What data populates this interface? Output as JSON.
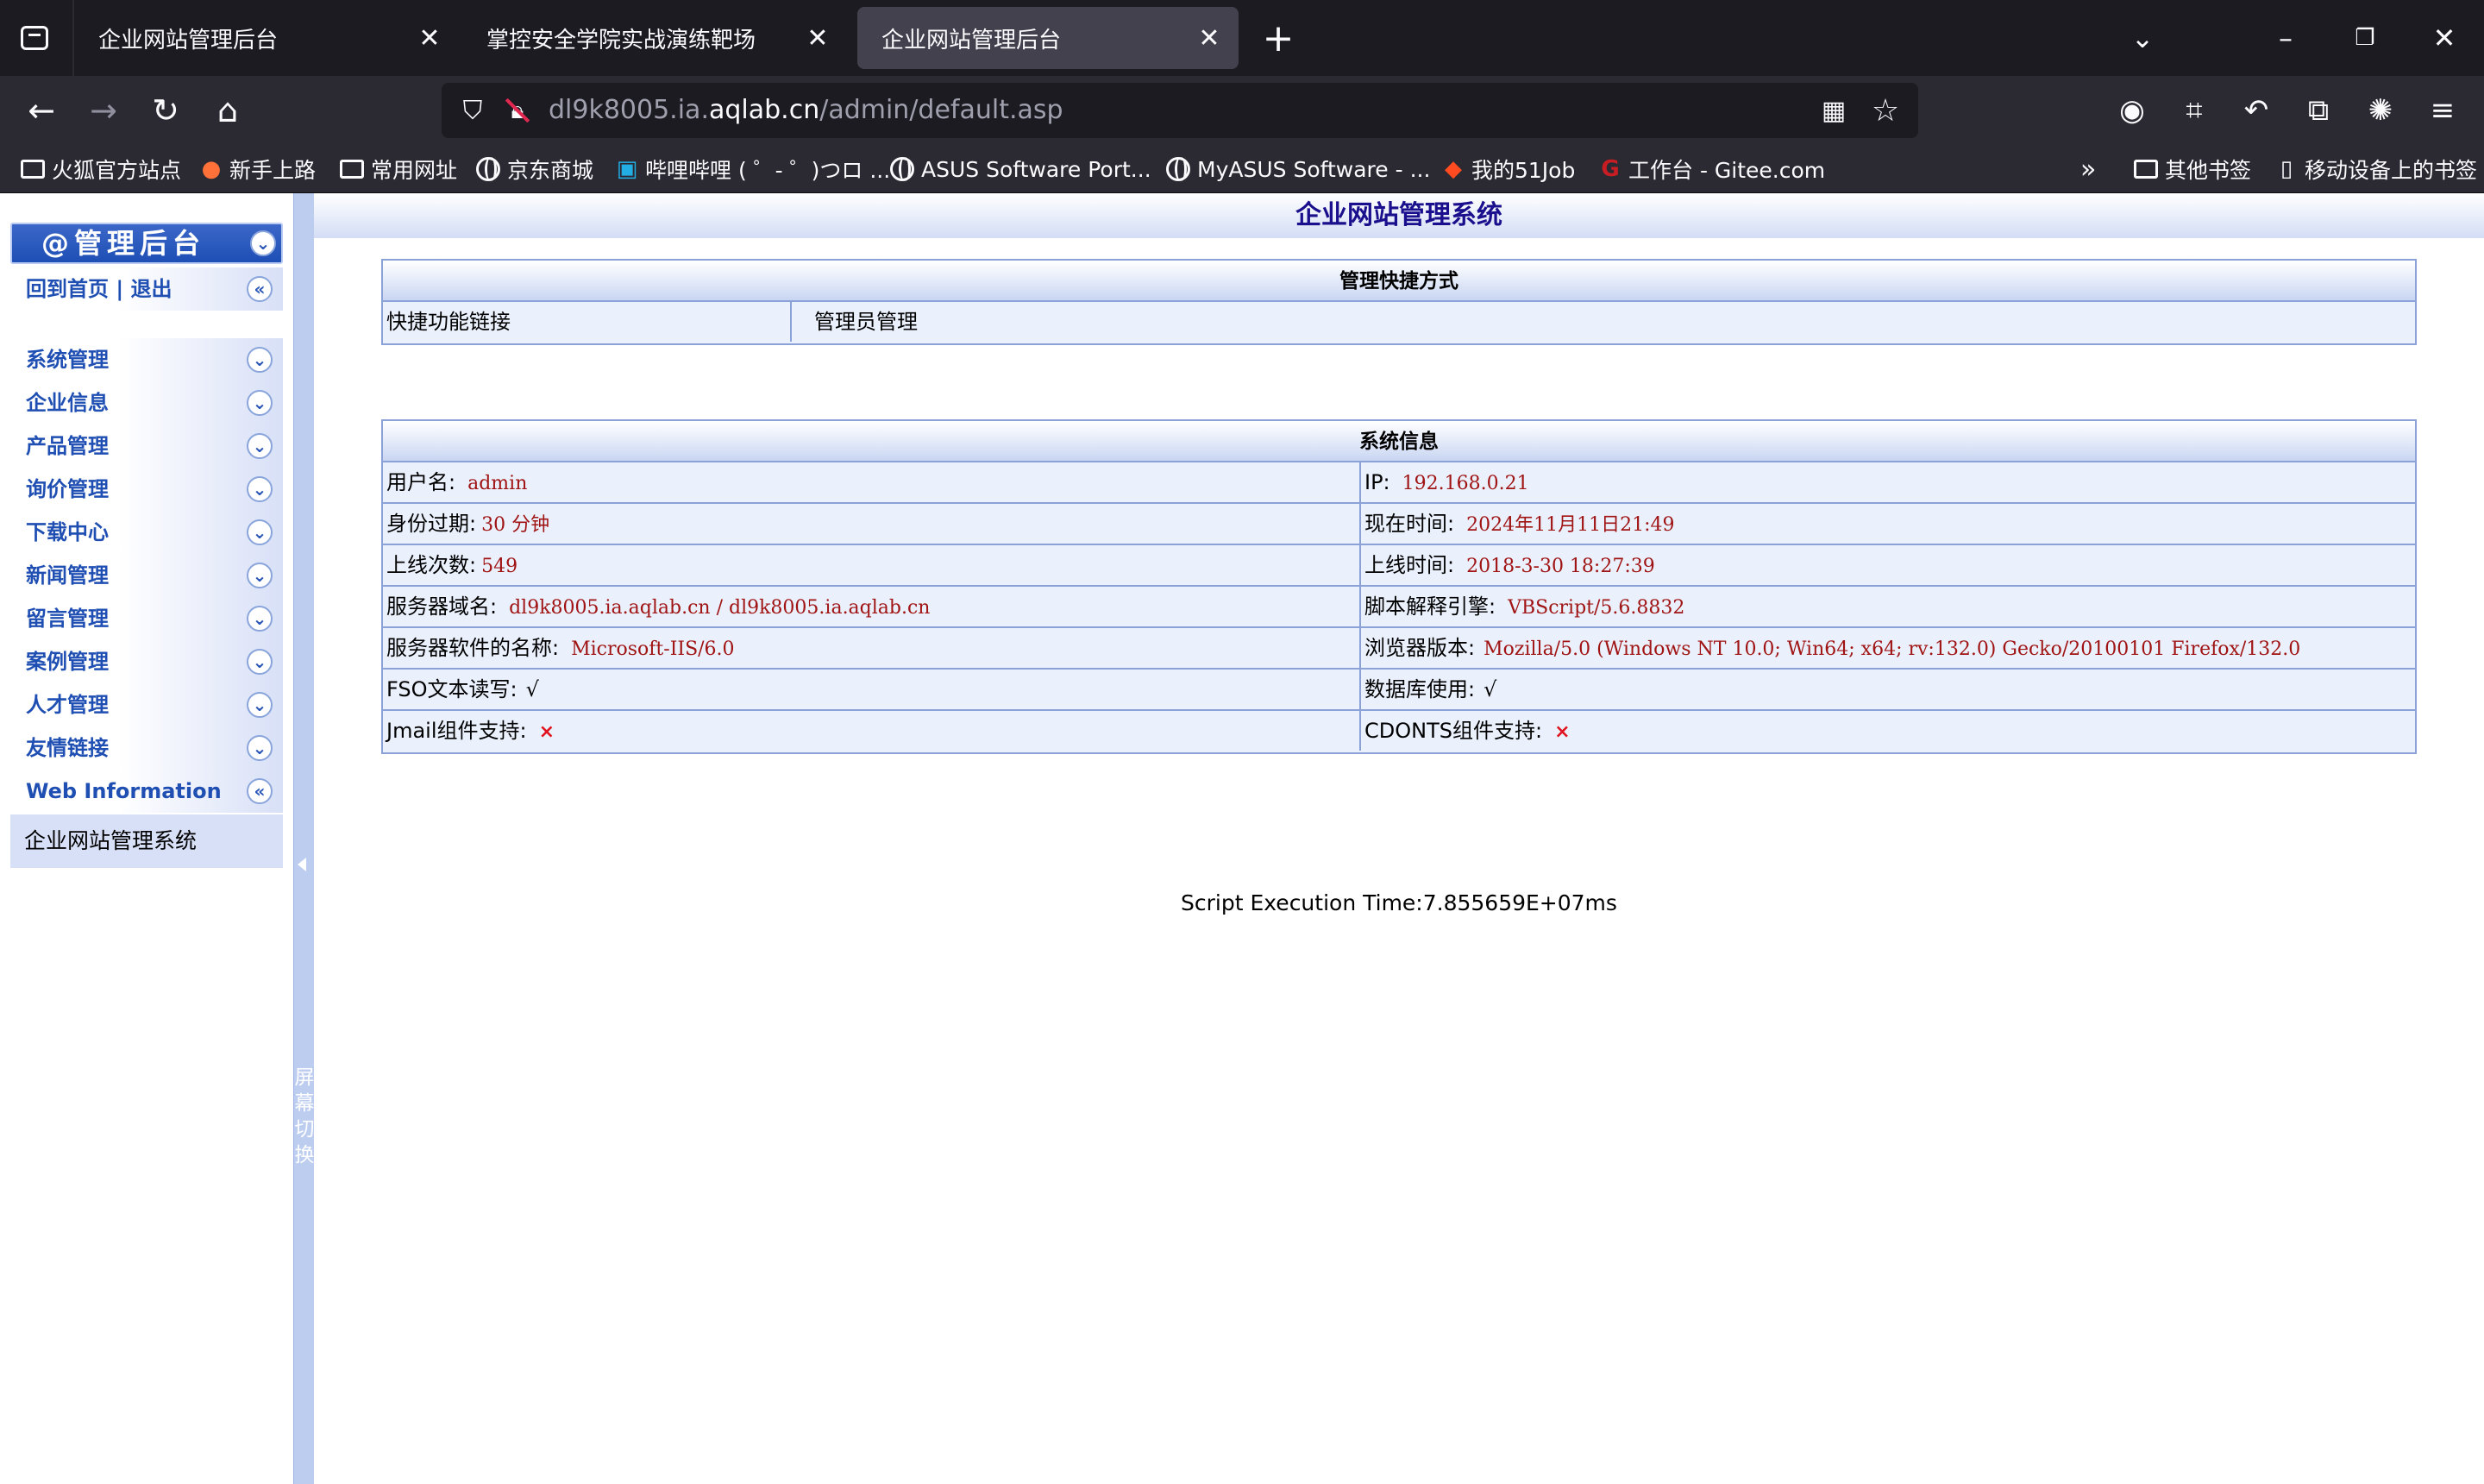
{
  "browser": {
    "tabs": [
      {
        "title": "企业网站管理后台",
        "active": false
      },
      {
        "title": "掌控安全学院实战演练靶场",
        "active": false
      },
      {
        "title": "企业网站管理后台",
        "active": true
      }
    ],
    "url_prefix": "dl9k8005.ia.",
    "url_host": "aqlab.cn",
    "url_path": "/admin/default.asp",
    "bookmarks": [
      "火狐官方站点",
      "新手上路",
      "常用网址",
      "京东商城",
      "哔哩哔哩 ( ゜- ゜)つロ ...",
      "ASUS Software Port...",
      "MyASUS Software - ...",
      "我的51Job",
      "工作台 - Gitee.com"
    ],
    "bookmarks_right": [
      "其他书签",
      "移动设备上的书签"
    ]
  },
  "sidebar": {
    "header": "@管理后台",
    "home_logout": "回到首页 | 退出",
    "items": [
      "系统管理",
      "企业信息",
      "产品管理",
      "询价管理",
      "下载中心",
      "新闻管理",
      "留言管理",
      "案例管理",
      "人才管理",
      "友情链接",
      "Web Information"
    ],
    "info_text": "企业网站管理系统",
    "switch_text": "屏\n幕\n切\n换"
  },
  "main": {
    "title": "企业网站管理系统",
    "shortcuts": {
      "heading": "管理快捷方式",
      "label": "快捷功能链接",
      "link": "管理员管理"
    },
    "sysinfo": {
      "heading": "系统信息",
      "rows": [
        {
          "l_label": "用户名:",
          "l_value": "admin",
          "r_label": "IP:",
          "r_value": "192.168.0.21"
        },
        {
          "l_label": "身份过期:",
          "l_value": "30 分钟",
          "r_label": "现在时间:",
          "r_value": "2024年11月11日21:49"
        },
        {
          "l_label": "上线次数:",
          "l_value": "549",
          "r_label": "上线时间:",
          "r_value": "2018-3-30 18:27:39"
        },
        {
          "l_label": "服务器域名:",
          "l_value": "dl9k8005.ia.aqlab.cn / dl9k8005.ia.aqlab.cn",
          "r_label": "脚本解释引擎:",
          "r_value": "VBScript/5.6.8832"
        },
        {
          "l_label": "服务器软件的名称:",
          "l_value": "Microsoft-IIS/6.0",
          "r_label": "浏览器版本:",
          "r_value": "Mozilla/5.0 (Windows NT 10.0; Win64; x64; rv:132.0) Gecko/20100101 Firefox/132.0"
        },
        {
          "l_label": "FSO文本读写:",
          "l_value": "√",
          "r_label": "数据库使用:",
          "r_value": "√"
        },
        {
          "l_label": "Jmail组件支持:",
          "l_value": "×",
          "r_label": "CDONTS组件支持:",
          "r_value": "×"
        }
      ]
    },
    "exec_time": "Script Execution Time:7.855659E+07ms"
  }
}
